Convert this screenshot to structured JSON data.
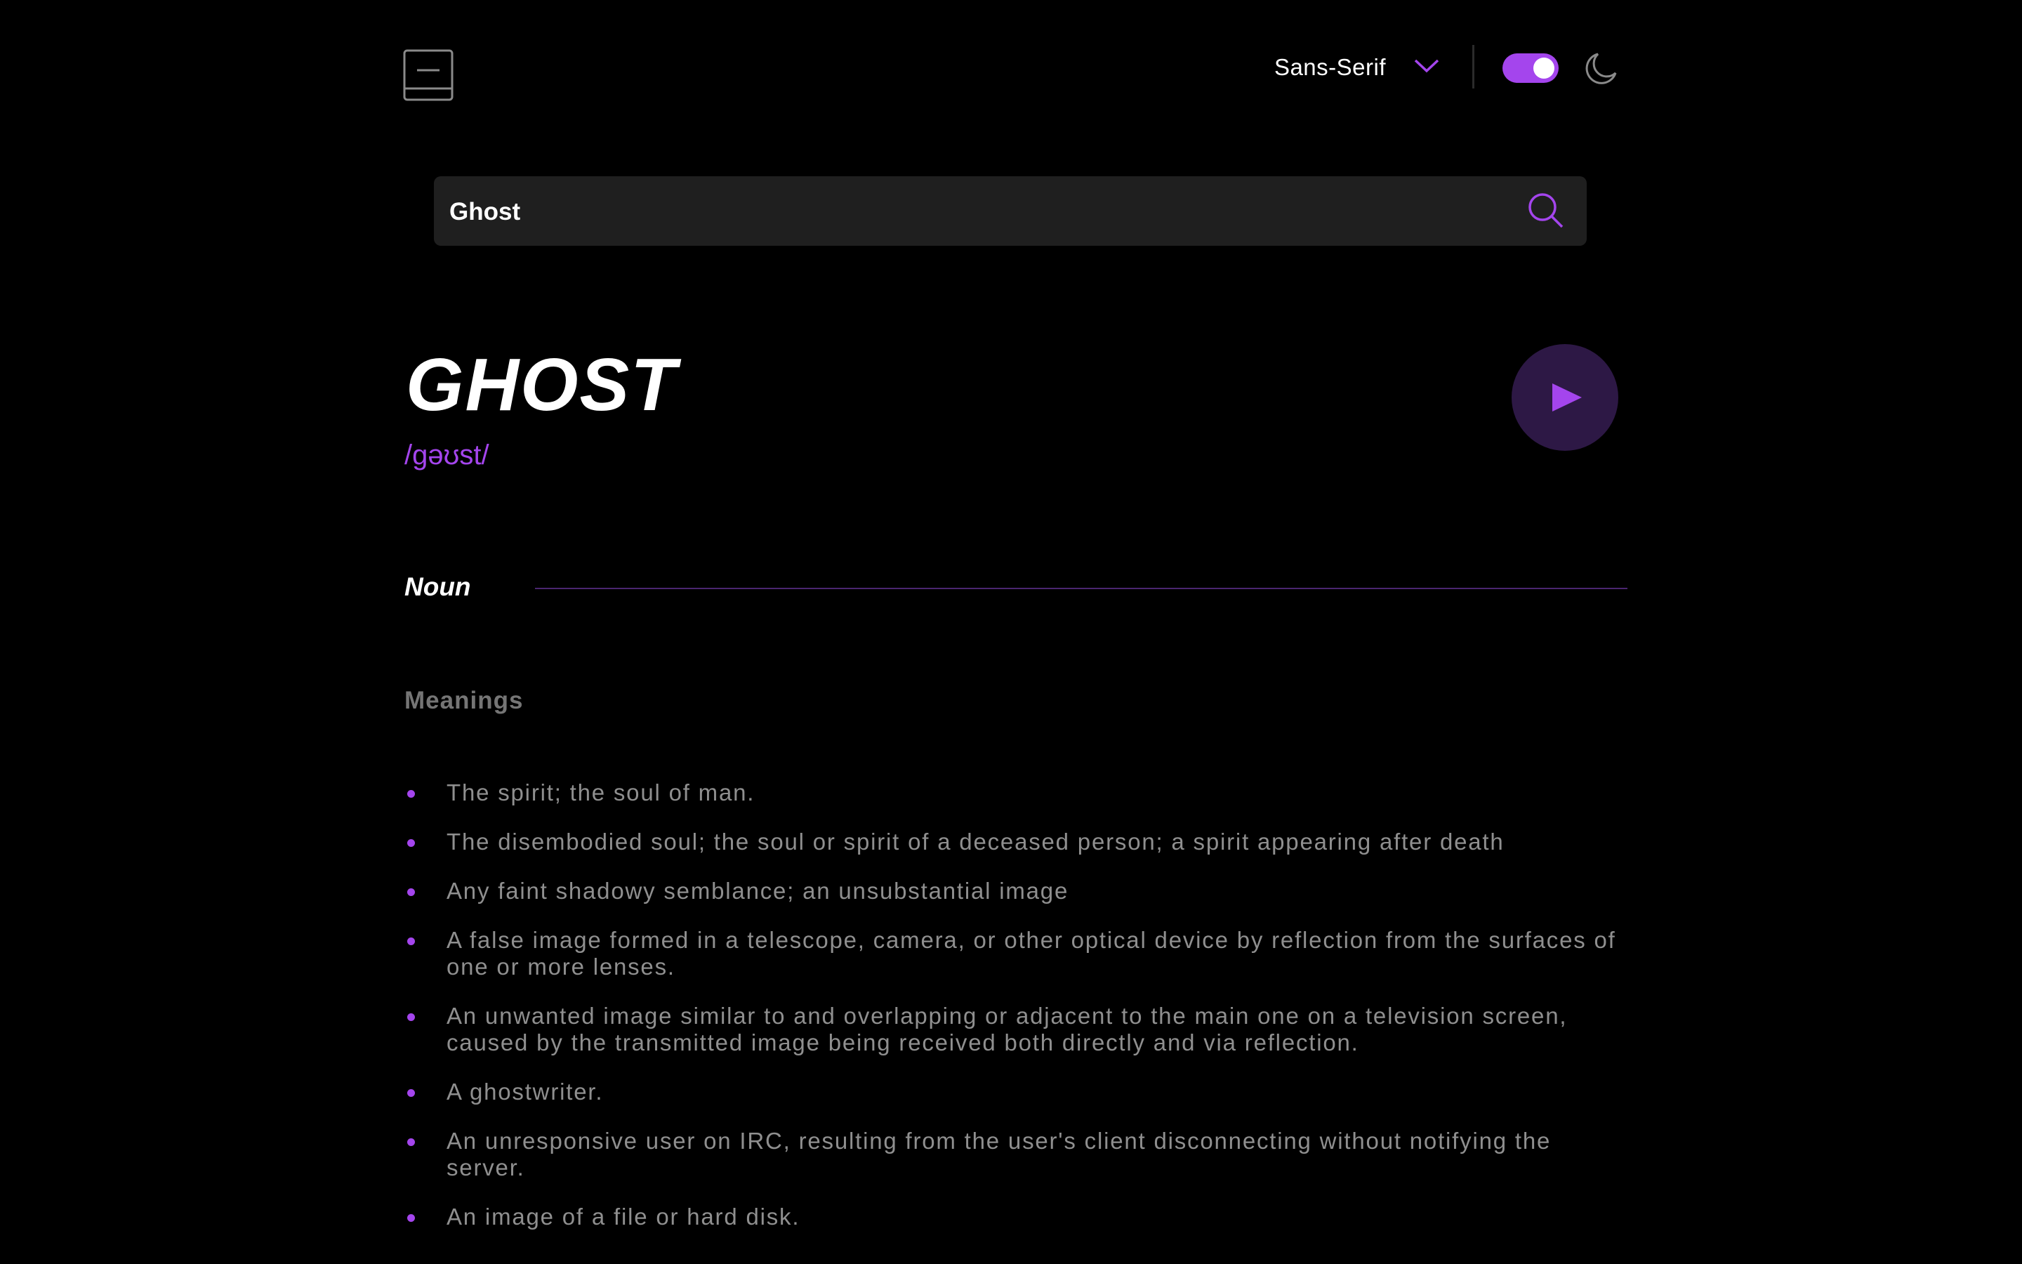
{
  "header": {
    "logo_icon": "book-icon",
    "font_selector": {
      "label": "Sans-Serif",
      "icon": "chevron-down-icon"
    },
    "theme_toggle": {
      "on": true,
      "color": "#a445ed"
    },
    "theme_icon": "moon-icon"
  },
  "search": {
    "value": "Ghost",
    "icon": "search-icon"
  },
  "entry": {
    "word": "GHOST",
    "phonetic": "/ɡəʊst/",
    "play_icon": "play-icon",
    "part_of_speech": "Noun",
    "meanings_heading": "Meanings",
    "meanings": [
      "The spirit; the soul of man.",
      "The disembodied soul; the soul or spirit of a deceased person; a spirit appearing after death",
      "Any faint shadowy semblance; an unsubstantial image",
      "A false image formed in a telescope, camera, or other optical device by reflection from the surfaces of one or more lenses.",
      "An unwanted image similar to and overlapping or adjacent to the main one on a television screen, caused by the transmitted image being received both directly and via reflection.",
      "A ghostwriter.",
      "An unresponsive user on IRC, resulting from the user's client disconnecting without notifying the server.",
      "An image of a file or hard disk."
    ]
  },
  "colors": {
    "accent": "#a445ed",
    "background": "#000000",
    "search_bg": "#1f1f1f"
  }
}
